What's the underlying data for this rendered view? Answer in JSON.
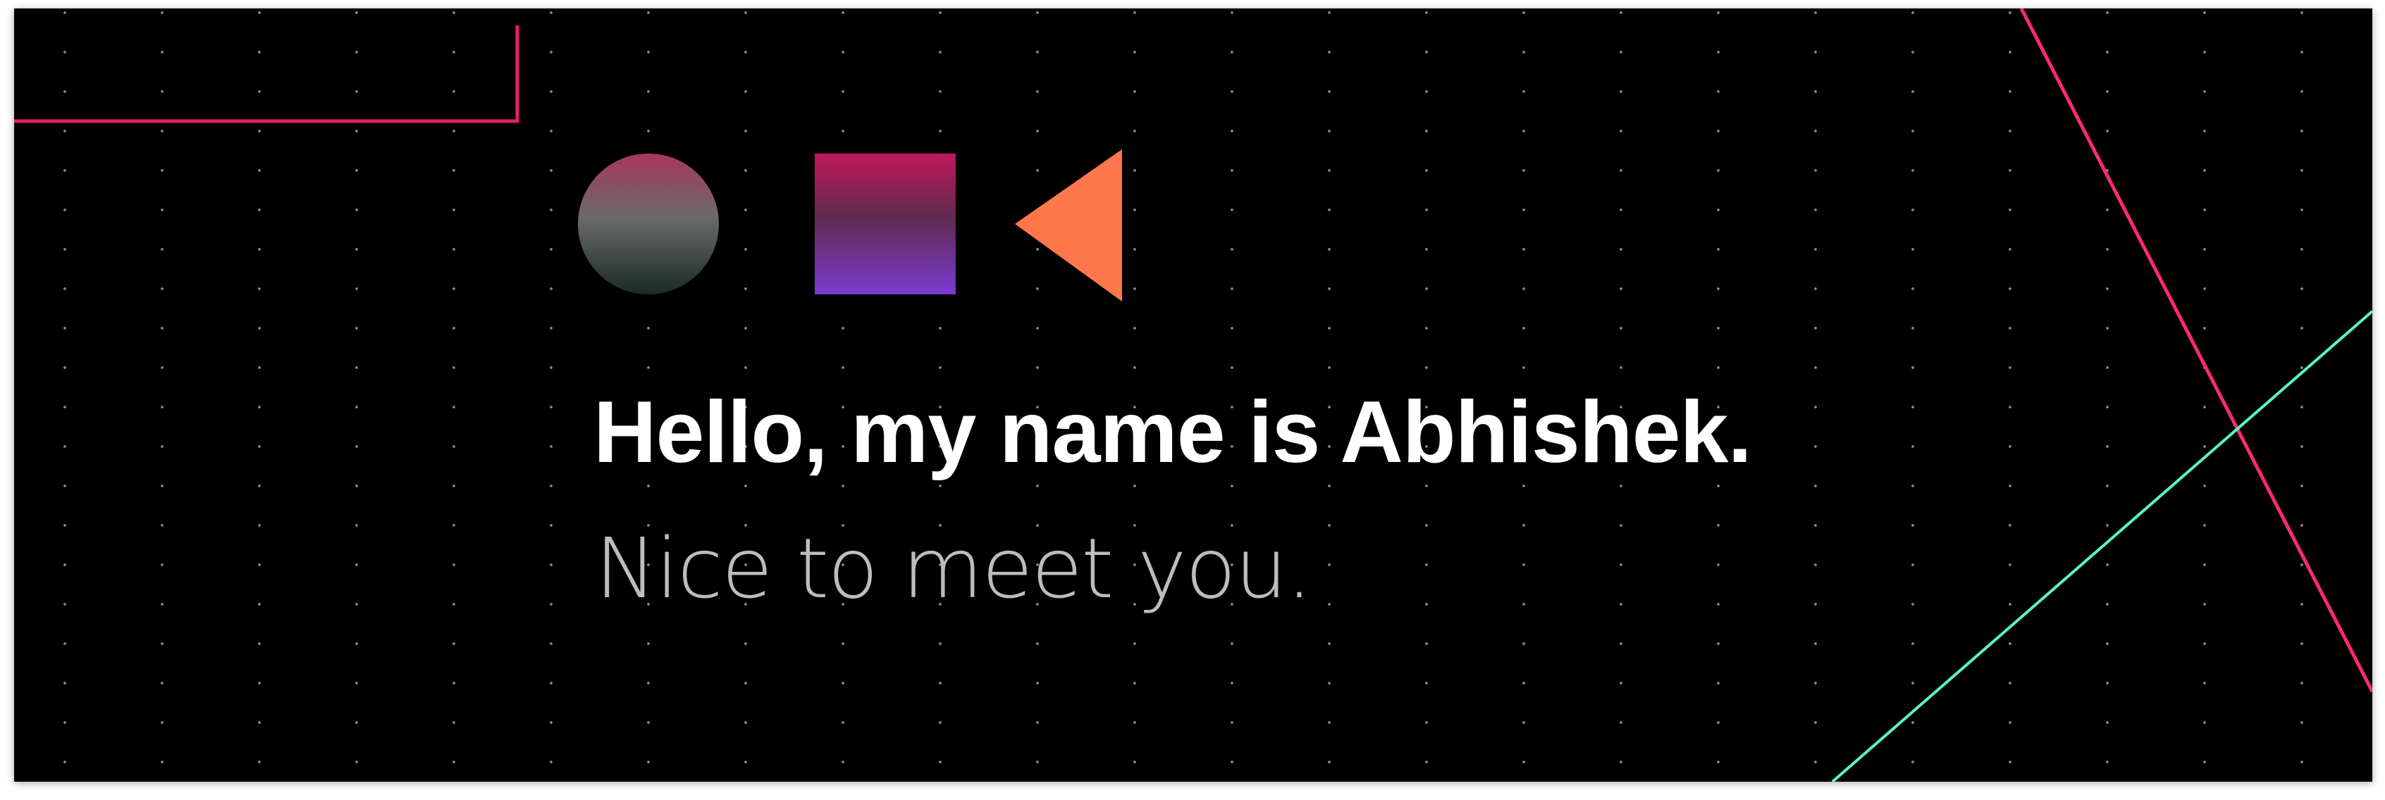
{
  "hero": {
    "headline": "Hello, my name is Abhishek.",
    "subline": "Nice to meet you."
  },
  "colors": {
    "background": "#000000",
    "accent_pink": "#ff2a6d",
    "accent_green": "#5af5c0",
    "triangle_orange": "#ff774a",
    "circle_top": "#a8375b",
    "circle_bottom": "#1a2b25",
    "square_top": "#c2185b",
    "square_bottom": "#7b3ad1"
  },
  "icons": {
    "circle": "circle-gradient-icon",
    "square": "square-gradient-icon",
    "triangle": "triangle-left-icon"
  }
}
